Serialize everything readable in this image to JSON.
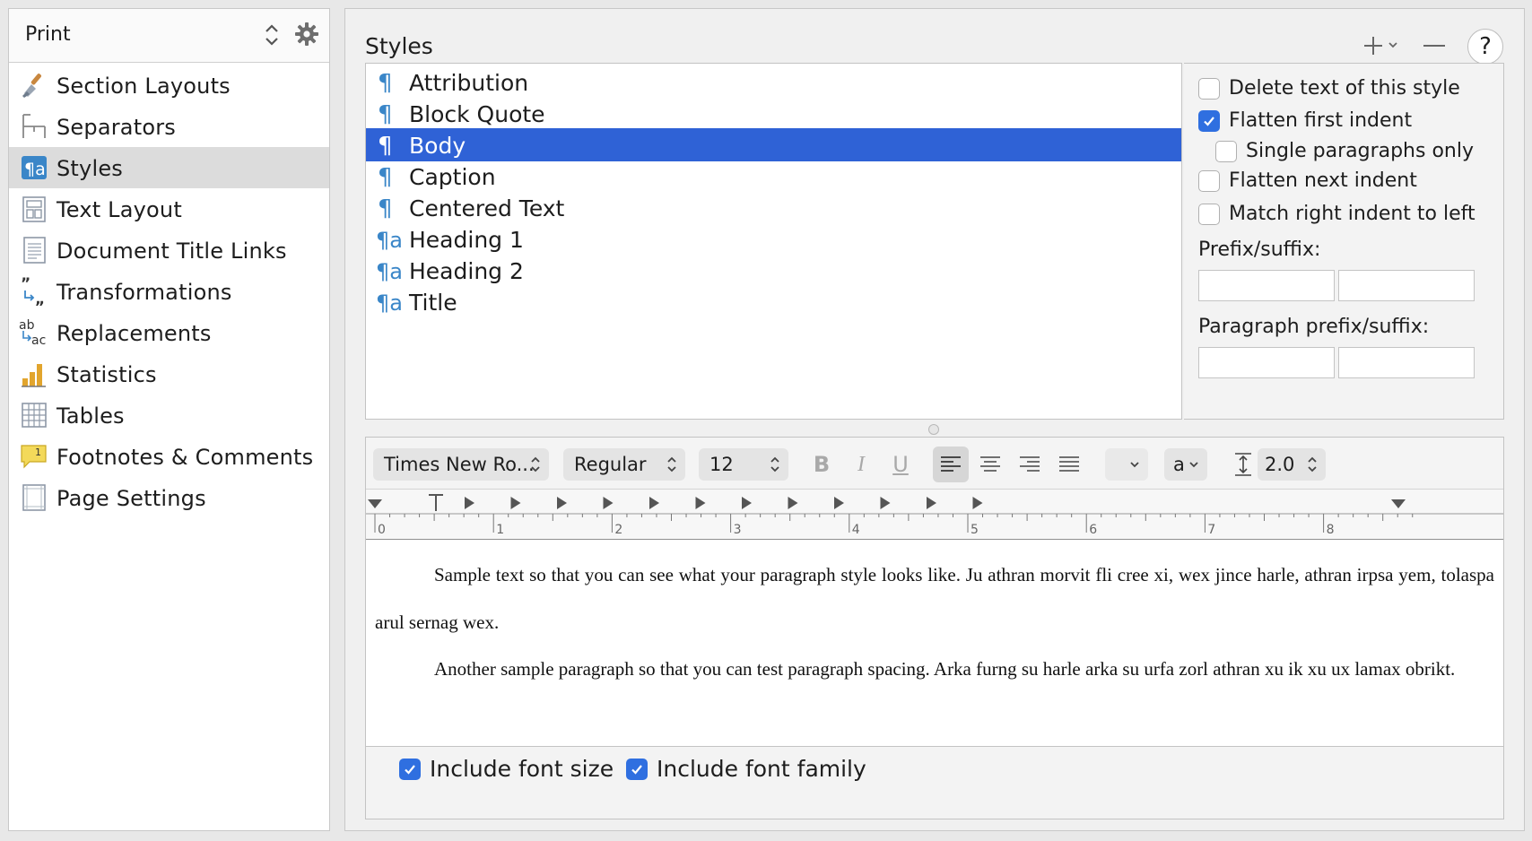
{
  "sidebar": {
    "header": {
      "title": "Print",
      "updown_icon": "updown-chevrons-icon",
      "gear_icon": "gear-icon"
    },
    "items": [
      {
        "label": "Section Layouts",
        "icon": "paintbrush-icon",
        "selected": false
      },
      {
        "label": "Separators",
        "icon": "separator-icon",
        "selected": false
      },
      {
        "label": "Styles",
        "icon": "paragraph-style-icon",
        "selected": true
      },
      {
        "label": "Text Layout",
        "icon": "text-layout-icon",
        "selected": false
      },
      {
        "label": "Document Title Links",
        "icon": "document-icon",
        "selected": false
      },
      {
        "label": "Transformations",
        "icon": "quote-transform-icon",
        "selected": false
      },
      {
        "label": "Replacements",
        "icon": "replace-icon",
        "selected": false
      },
      {
        "label": "Statistics",
        "icon": "bar-chart-icon",
        "selected": false
      },
      {
        "label": "Tables",
        "icon": "table-icon",
        "selected": false
      },
      {
        "label": "Footnotes & Comments",
        "icon": "comment-icon",
        "selected": false
      },
      {
        "label": "Page Settings",
        "icon": "page-settings-icon",
        "selected": false
      }
    ]
  },
  "main": {
    "title": "Styles",
    "toolbar": {
      "add_icon": "plus-icon",
      "remove_icon": "minus-icon",
      "help_label": "?"
    },
    "styles": [
      {
        "name": "Attribution",
        "type": "paragraph"
      },
      {
        "name": "Block Quote",
        "type": "paragraph"
      },
      {
        "name": "Body",
        "type": "paragraph",
        "selected": true
      },
      {
        "name": "Caption",
        "type": "paragraph"
      },
      {
        "name": "Centered Text",
        "type": "paragraph"
      },
      {
        "name": "Heading 1",
        "type": "paragraph-character"
      },
      {
        "name": "Heading 2",
        "type": "paragraph-character"
      },
      {
        "name": "Title",
        "type": "paragraph-character"
      }
    ],
    "options": {
      "delete_text": {
        "label": "Delete text of this style",
        "checked": false
      },
      "flatten_first": {
        "label": "Flatten first indent",
        "checked": true
      },
      "single_paragraphs": {
        "label": "Single paragraphs only",
        "checked": false
      },
      "flatten_next": {
        "label": "Flatten next indent",
        "checked": false
      },
      "match_right": {
        "label": "Match right indent to left",
        "checked": false
      },
      "prefix_suffix_label": "Prefix/suffix:",
      "prefix_value": "",
      "suffix_value": "",
      "para_prefix_suffix_label": "Paragraph prefix/suffix:",
      "para_prefix_value": "",
      "para_suffix_value": ""
    },
    "format_bar": {
      "font_family": "Times New Ro...",
      "font_style": "Regular",
      "font_size": "12",
      "bold": "B",
      "italic": "I",
      "underline": "U",
      "alignment_selected": "left",
      "text_color_popup": "",
      "character_case": "a",
      "line_spacing": "2.0"
    },
    "ruler": {
      "labels": [
        "0",
        "1",
        "2",
        "3",
        "4",
        "5",
        "6",
        "7",
        "8"
      ]
    },
    "preview": {
      "paragraph1": "Sample text so that you can see what your paragraph style looks like. Ju athran morvit fli cree xi, wex jince harle, athran irpsa yem, tolaspa arul sernag wex.",
      "paragraph2": "Another sample paragraph so that you can test paragraph spacing. Arka furng su harle arka su urfa zorl athran xu ik xu ux lamax obrikt."
    },
    "include": {
      "font_size": {
        "label": "Include font size",
        "checked": true
      },
      "font_family": {
        "label": "Include font family",
        "checked": true
      }
    }
  },
  "colors": {
    "accent": "#2f62d6",
    "checkbox": "#2f6fe0",
    "icon_blue": "#3a86c8"
  }
}
